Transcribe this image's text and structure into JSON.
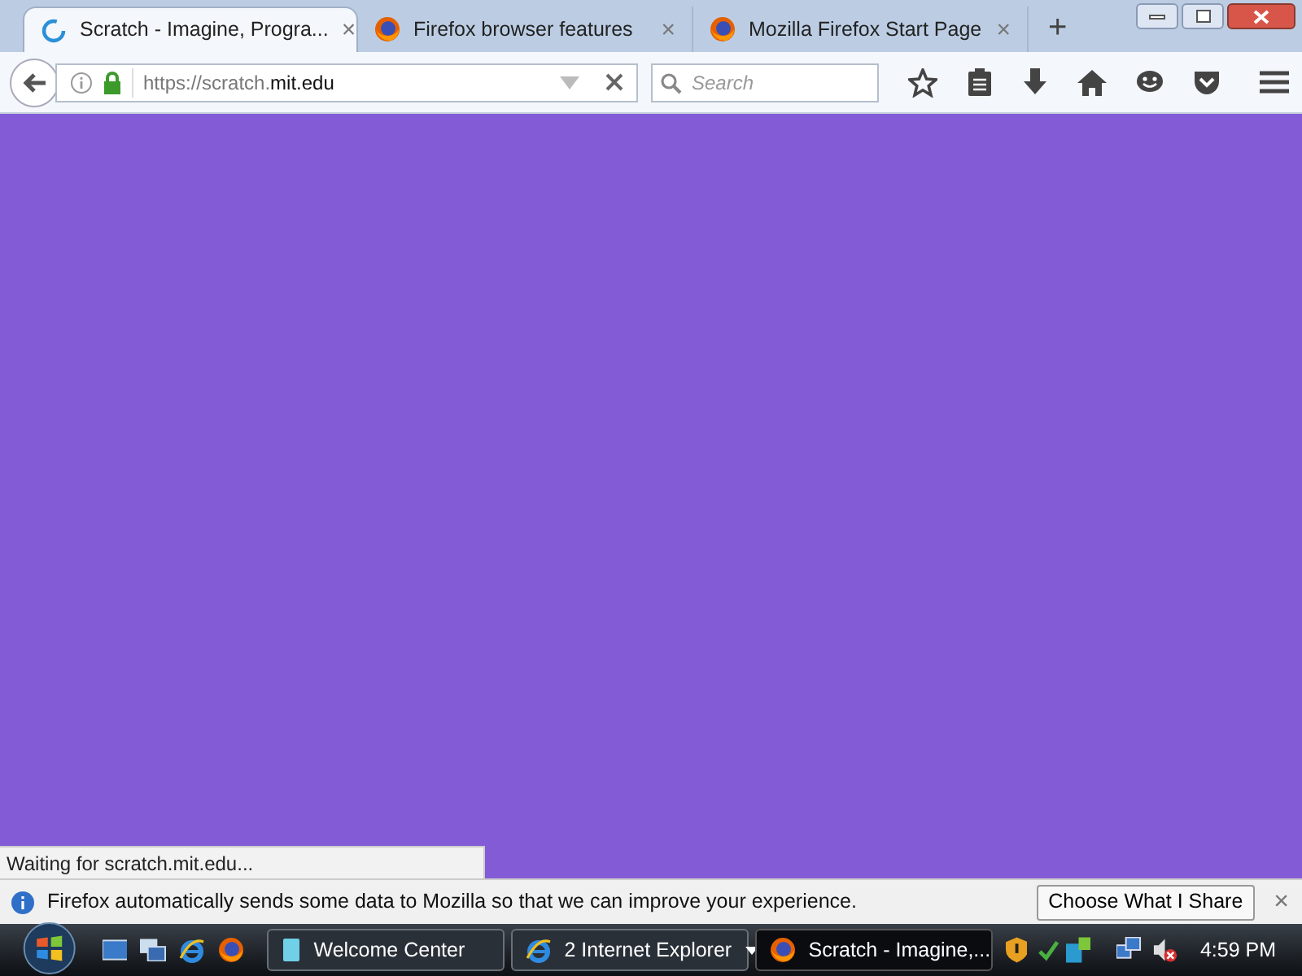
{
  "tabs": [
    {
      "title": "Scratch - Imagine, Progra...",
      "selected": true,
      "loading": true,
      "close": "×"
    },
    {
      "title": "Firefox browser features",
      "selected": false,
      "loading": false,
      "close": "×"
    },
    {
      "title": "Mozilla Firefox Start Page",
      "selected": false,
      "loading": false,
      "close": "×"
    }
  ],
  "new_tab": "+",
  "address_bar": {
    "url": "https://scratch.**mit.edu**"
  },
  "search": {
    "placeholder": "Search"
  },
  "status_text": "Waiting for scratch.mit.edu...",
  "notification": {
    "message": "Firefox automatically sends some data to Mozilla so that we can improve your experience.",
    "button": "Choose What I Share",
    "close": "×"
  },
  "taskbar": {
    "buttons": [
      {
        "label": "Welcome Center",
        "kind": "document",
        "selected": false
      },
      {
        "label": "2 Internet Explorer",
        "kind": "ie-group",
        "selected": false
      },
      {
        "label": "Scratch - Imagine,...",
        "kind": "firefox",
        "selected": true
      }
    ],
    "clock": "4:59 PM"
  }
}
